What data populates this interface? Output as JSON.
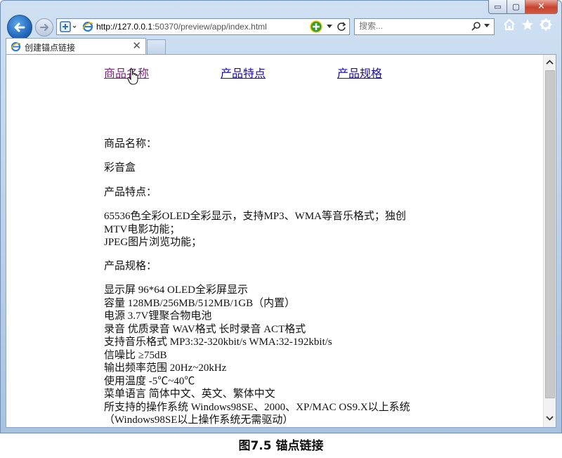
{
  "browser": {
    "window_controls": {
      "minimize": "▭",
      "maximize": "▢",
      "close": "✕"
    },
    "url_host": "http://127.0.0.1",
    "url_rest": ":50370/preview/app/index.html",
    "search_placeholder": "搜索...",
    "tab_title": "创建锚点链接",
    "tab_close": "✕"
  },
  "nav": {
    "links": [
      {
        "label": "商品名称",
        "state": "visited"
      },
      {
        "label": "产品特点",
        "state": "normal"
      },
      {
        "label": "产品规格",
        "state": "normal"
      }
    ]
  },
  "sections": {
    "name_heading": "商品名称：",
    "name_value": "彩音盒",
    "features_heading": "产品特点：",
    "features_lines": [
      "65536色全彩OLED全彩显示，支持MP3、WMA等音乐格式；独创",
      "MTV电影功能；",
      "JPEG图片浏览功能；"
    ],
    "specs_heading": "产品规格：",
    "specs_lines": [
      "显示屏 96*64 OLED全彩屏显示",
      "容量 128MB/256MB/512MB/1GB（内置）",
      "电源 3.7V锂聚合物电池",
      "录音 优质录音 WAV格式 长时录音 ACT格式",
      "支持音乐格式 MP3:32-320kbit/s WMA:32-192kbit/s",
      "信噪比 ≥75dB",
      "输出频率范围 20Hz~20kHz",
      "使用温度 -5℃~40℃",
      "菜单语言 简体中文、英文、繁体中文",
      "所支持的操作系统 Windows98SE、2000、XP/MAC OS9.X以上系统",
      "（Windows98SE以上操作系统无需驱动）"
    ]
  },
  "caption": "图7.5 锚点链接",
  "colors": {
    "link": "#1a0dab",
    "visited": "#7a1f7a",
    "accent": "#1b5fb3"
  }
}
